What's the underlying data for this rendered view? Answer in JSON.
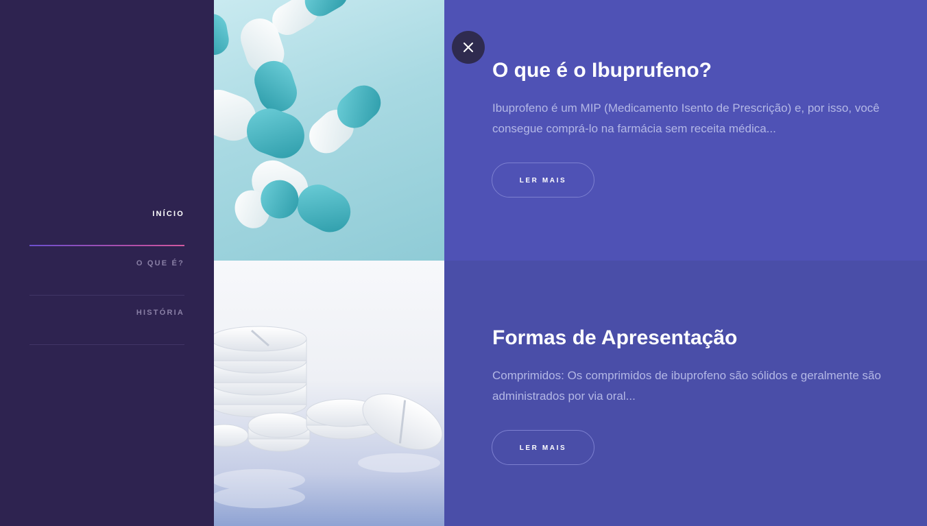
{
  "nav": {
    "items": [
      {
        "label": "INÍCIO",
        "active": true
      },
      {
        "label": "O QUE É?",
        "active": false
      },
      {
        "label": "HISTÓRIA",
        "active": false
      }
    ]
  },
  "cards": [
    {
      "title": "O que é o Ibuprufeno?",
      "text": "Ibuprofeno é um MIP (Medicamento Isento de Prescrição) e, por isso, você consegue comprá-lo na farmácia sem receita médica...",
      "button": "LER MAIS",
      "image_icon": "capsules-image"
    },
    {
      "title": "Formas de Apresentação",
      "text": "Comprimidos: Os comprimidos de ibuprofeno são sólidos e geralmente são administrados por via oral...",
      "button": "LER MAIS",
      "image_icon": "tablets-image"
    }
  ],
  "close_icon": "close-icon",
  "colors": {
    "sidebar": "#2e2350",
    "panel_top": "#4f52b5",
    "panel_bottom": "#4a4ea8",
    "accent_gradient_start": "#6c4fcf",
    "accent_gradient_end": "#d25aa0",
    "capsule_teal": "#3fb3c0"
  }
}
